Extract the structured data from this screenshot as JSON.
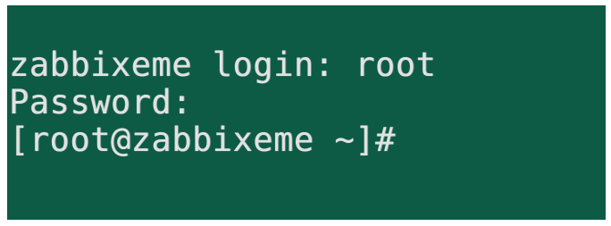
{
  "terminal": {
    "background_color": "#0d5a45",
    "text_color": "#e2e2e2",
    "lines": [
      "zabbixeme login: root",
      "Password:",
      "[root@zabbixeme ~]#"
    ]
  }
}
